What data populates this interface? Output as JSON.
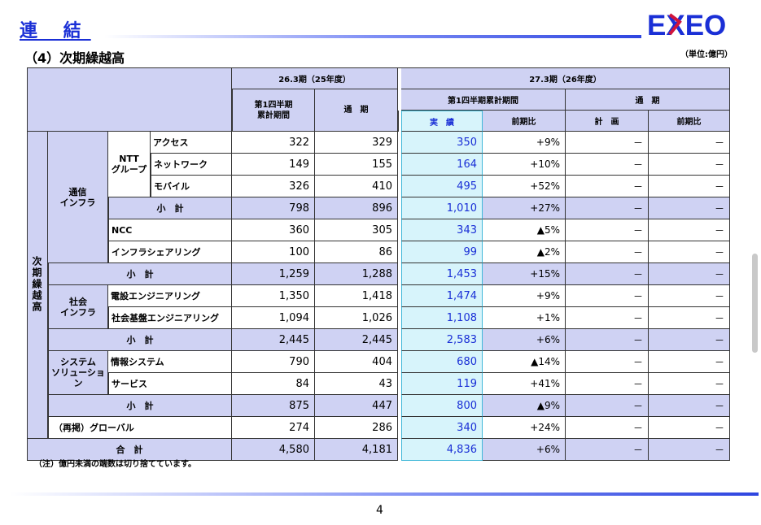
{
  "header": {
    "title": "連 結",
    "subtitle": "（4）次期繰越高",
    "unit": "（単位:億円）",
    "logo_text": "EXEO"
  },
  "columns": {
    "group1": "26.3期（25年度）",
    "group2": "27.3期（26年度）",
    "q1_cum": "第1四半期\n累計期間",
    "full_year": "通　期",
    "q1_cum2": "第1四半期累計期間",
    "full_year2": "通　期",
    "actual": "実　績",
    "yoy": "前期比",
    "plan": "計　画",
    "yoy2": "前期比"
  },
  "labels": {
    "vertical": "次期繰越高",
    "tsushin": "通信\nインフラ",
    "ntt": "NTT\nグループ",
    "shakai": "社会\nインフラ",
    "system": "システム\nソリューション",
    "subtotal": "小　計",
    "total": "合　計"
  },
  "rows": [
    {
      "label": "アクセス",
      "v1": "322",
      "v2": "329",
      "v3": "350",
      "v4": "+9%",
      "v5": "－",
      "v6": "－"
    },
    {
      "label": "ネットワーク",
      "v1": "149",
      "v2": "155",
      "v3": "164",
      "v4": "+10%",
      "v5": "－",
      "v6": "－"
    },
    {
      "label": "モバイル",
      "v1": "326",
      "v2": "410",
      "v3": "495",
      "v4": "+52%",
      "v5": "－",
      "v6": "－"
    },
    {
      "label": "小　計",
      "v1": "798",
      "v2": "896",
      "v3": "1,010",
      "v4": "+27%",
      "v5": "－",
      "v6": "－"
    },
    {
      "label": "NCC",
      "v1": "360",
      "v2": "305",
      "v3": "343",
      "v4": "▲5%",
      "v5": "－",
      "v6": "－"
    },
    {
      "label": "インフラシェアリング",
      "v1": "100",
      "v2": "86",
      "v3": "99",
      "v4": "▲2%",
      "v5": "－",
      "v6": "－"
    },
    {
      "label": "小　計",
      "v1": "1,259",
      "v2": "1,288",
      "v3": "1,453",
      "v4": "+15%",
      "v5": "－",
      "v6": "－"
    },
    {
      "label": "電設エンジニアリング",
      "v1": "1,350",
      "v2": "1,418",
      "v3": "1,474",
      "v4": "+9%",
      "v5": "－",
      "v6": "－"
    },
    {
      "label": "社会基盤エンジニアリング",
      "v1": "1,094",
      "v2": "1,026",
      "v3": "1,108",
      "v4": "+1%",
      "v5": "－",
      "v6": "－"
    },
    {
      "label": "小　計",
      "v1": "2,445",
      "v2": "2,445",
      "v3": "2,583",
      "v4": "+6%",
      "v5": "－",
      "v6": "－"
    },
    {
      "label": "情報システム",
      "v1": "790",
      "v2": "404",
      "v3": "680",
      "v4": "▲14%",
      "v5": "－",
      "v6": "－"
    },
    {
      "label": "サービス",
      "v1": "84",
      "v2": "43",
      "v3": "119",
      "v4": "+41%",
      "v5": "－",
      "v6": "－"
    },
    {
      "label": "小　計",
      "v1": "875",
      "v2": "447",
      "v3": "800",
      "v4": "▲9%",
      "v5": "－",
      "v6": "－"
    },
    {
      "label": "（再掲）グローバル",
      "v1": "274",
      "v2": "286",
      "v3": "340",
      "v4": "+24%",
      "v5": "－",
      "v6": "－"
    },
    {
      "label": "合　計",
      "v1": "4,580",
      "v2": "4,181",
      "v3": "4,836",
      "v4": "+6%",
      "v5": "－",
      "v6": "－"
    }
  ],
  "note": "（注）億円未満の端数は切り捨てています。",
  "page_number": "4",
  "colors": {
    "title_blue": "#1a2fd6",
    "logo_red": "#d0143c",
    "shade": "#cfd2f3",
    "highlight": "#d7f4fb"
  }
}
